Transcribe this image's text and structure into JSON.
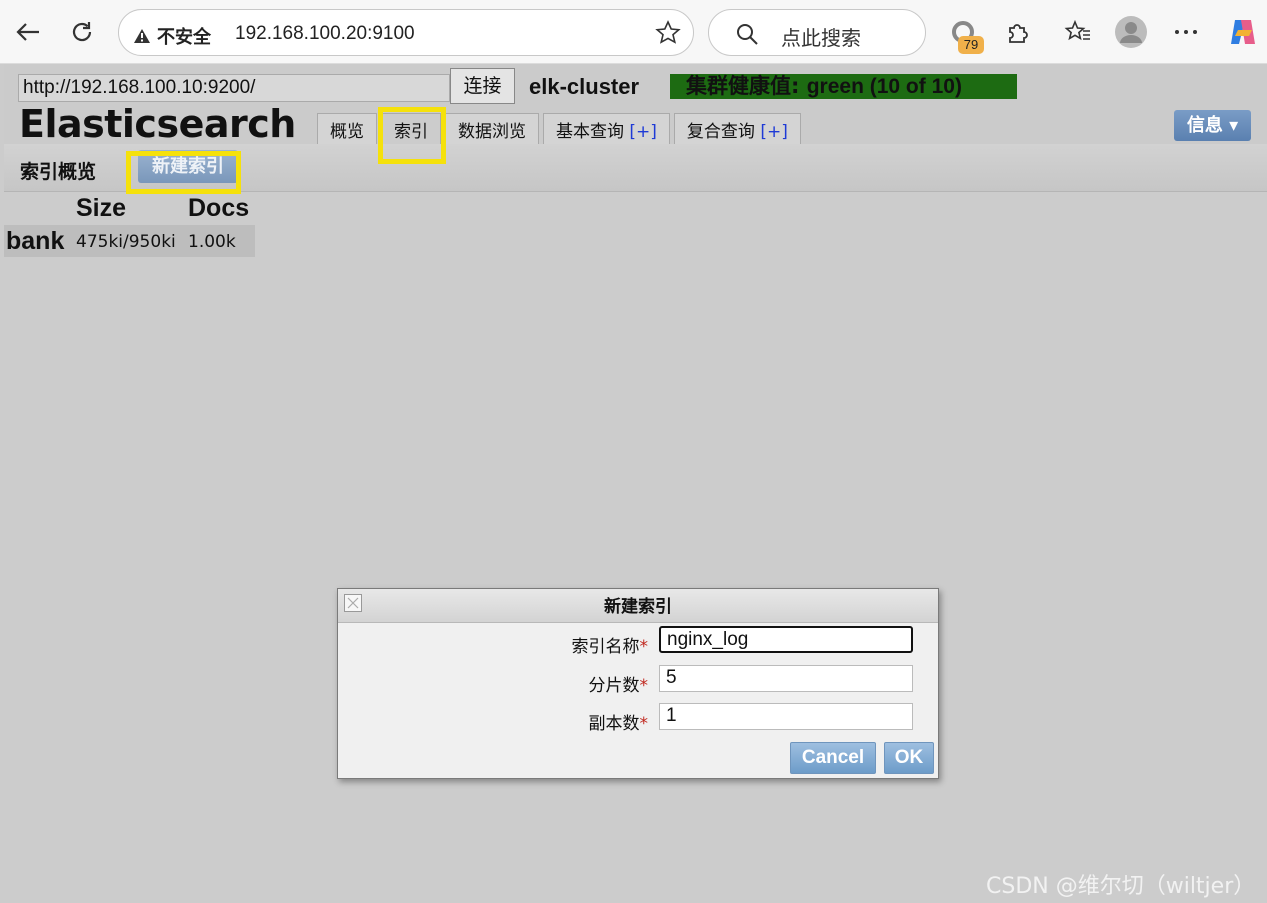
{
  "browser": {
    "security_label": "不安全",
    "url": "192.168.100.20:9100",
    "search_label": "点此搜索",
    "extension_badge": "79"
  },
  "header": {
    "endpoint_value": "http://192.168.100.10:9200/",
    "connect_label": "连接",
    "cluster_name": "elk-cluster",
    "health_prefix": "集群健康值: ",
    "health_value": "green (10 of 10)",
    "brand": "Elasticsearch",
    "info_label": "信息 ▾",
    "tabs": [
      {
        "label": "概览"
      },
      {
        "label": "索引"
      },
      {
        "label": "数据浏览"
      },
      {
        "label": "基本查询",
        "plus": "[+]"
      },
      {
        "label": "复合查询",
        "plus": "[+]"
      }
    ]
  },
  "subbar": {
    "title": "索引概览",
    "new_index_label": "新建索引"
  },
  "index_table": {
    "headers": {
      "size": "Size",
      "docs": "Docs"
    },
    "rows": [
      {
        "name": "bank",
        "size": "475ki/950ki",
        "docs": "1.00k"
      }
    ]
  },
  "dialog": {
    "title": "新建索引",
    "fields": [
      {
        "label": "索引名称",
        "required": "*",
        "value": "nginx_log"
      },
      {
        "label": "分片数",
        "required": "*",
        "value": "5"
      },
      {
        "label": "副本数",
        "required": "*",
        "value": "1"
      }
    ],
    "cancel_label": "Cancel",
    "ok_label": "OK"
  },
  "watermark": "CSDN @维尔切（wiltjer）",
  "colors": {
    "health": "#1d6b12",
    "highlight": "#f5e10b",
    "button_blue": "#6d9cc9"
  }
}
